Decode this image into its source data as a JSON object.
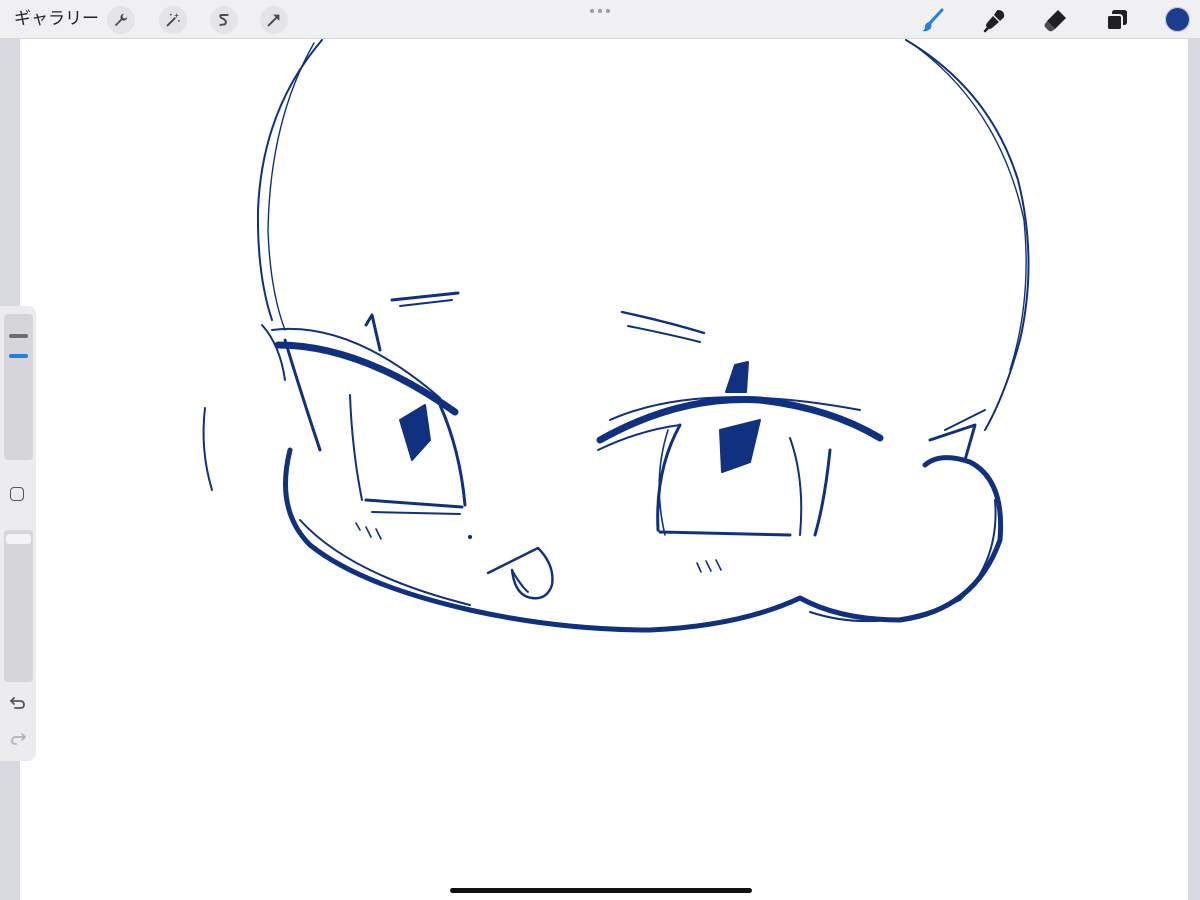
{
  "topbar": {
    "gallery_label": "ギャラリー",
    "left_tools": [
      "wrench-icon",
      "magic-wand-icon",
      "selection-s-icon",
      "transform-arrow-icon"
    ],
    "right_tools": [
      "brush-icon",
      "smudge-icon",
      "eraser-icon",
      "layers-icon"
    ],
    "active_tool": "brush",
    "color": {
      "current": "#1a3d8f"
    }
  },
  "sidebar": {
    "brush_size": 0.18,
    "opacity": 1.0,
    "controls": [
      "brush-size-slider",
      "modify-button",
      "opacity-slider",
      "undo-icon",
      "redo-icon"
    ]
  },
  "canvas": {
    "stroke_color": "#10317f",
    "background": "#ffffff"
  }
}
